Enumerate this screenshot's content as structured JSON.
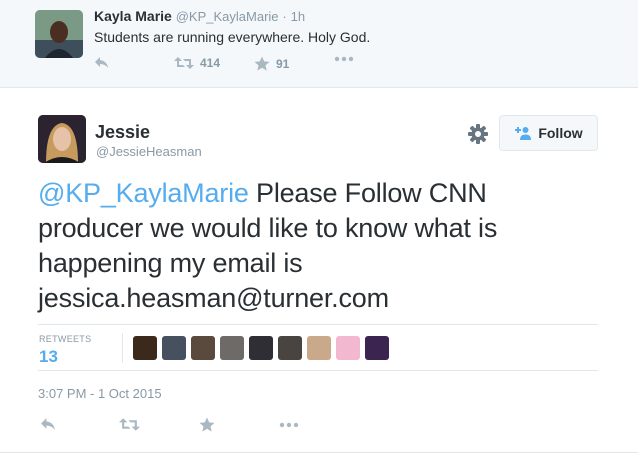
{
  "parent_tweet": {
    "name": "Kayla Marie",
    "handle": "@KP_KaylaMarie",
    "separator": "·",
    "time": "1h",
    "text": "Students are running everywhere. Holy God.",
    "retweet_count": "414",
    "favorite_count": "91"
  },
  "tweet": {
    "name": "Jessie",
    "handle": "@JessieHeasman",
    "follow_label": "Follow",
    "mention": "@KP_KaylaMarie",
    "text": " Please Follow CNN producer we would like to know what is happening my email is jessica.heasman@turner.com",
    "retweets_label": "RETWEETS",
    "retweets_count": "13",
    "timestamp": "3:07 PM - 1 Oct 2015"
  },
  "retweeter_avatar_colors": [
    "#3b2a1c",
    "#46505e",
    "#5a4a3e",
    "#6d6a68",
    "#2e2e34",
    "#4a4440",
    "#c9a98a",
    "#f2b8cf",
    "#3c2450"
  ],
  "colors": {
    "link": "#55acee",
    "muted": "#8899a6",
    "icon": "#aab8c2",
    "text": "#292f33"
  },
  "icons": [
    "reply-icon",
    "retweet-icon",
    "favorite-icon",
    "more-icon",
    "gear-icon",
    "add-user-icon"
  ]
}
